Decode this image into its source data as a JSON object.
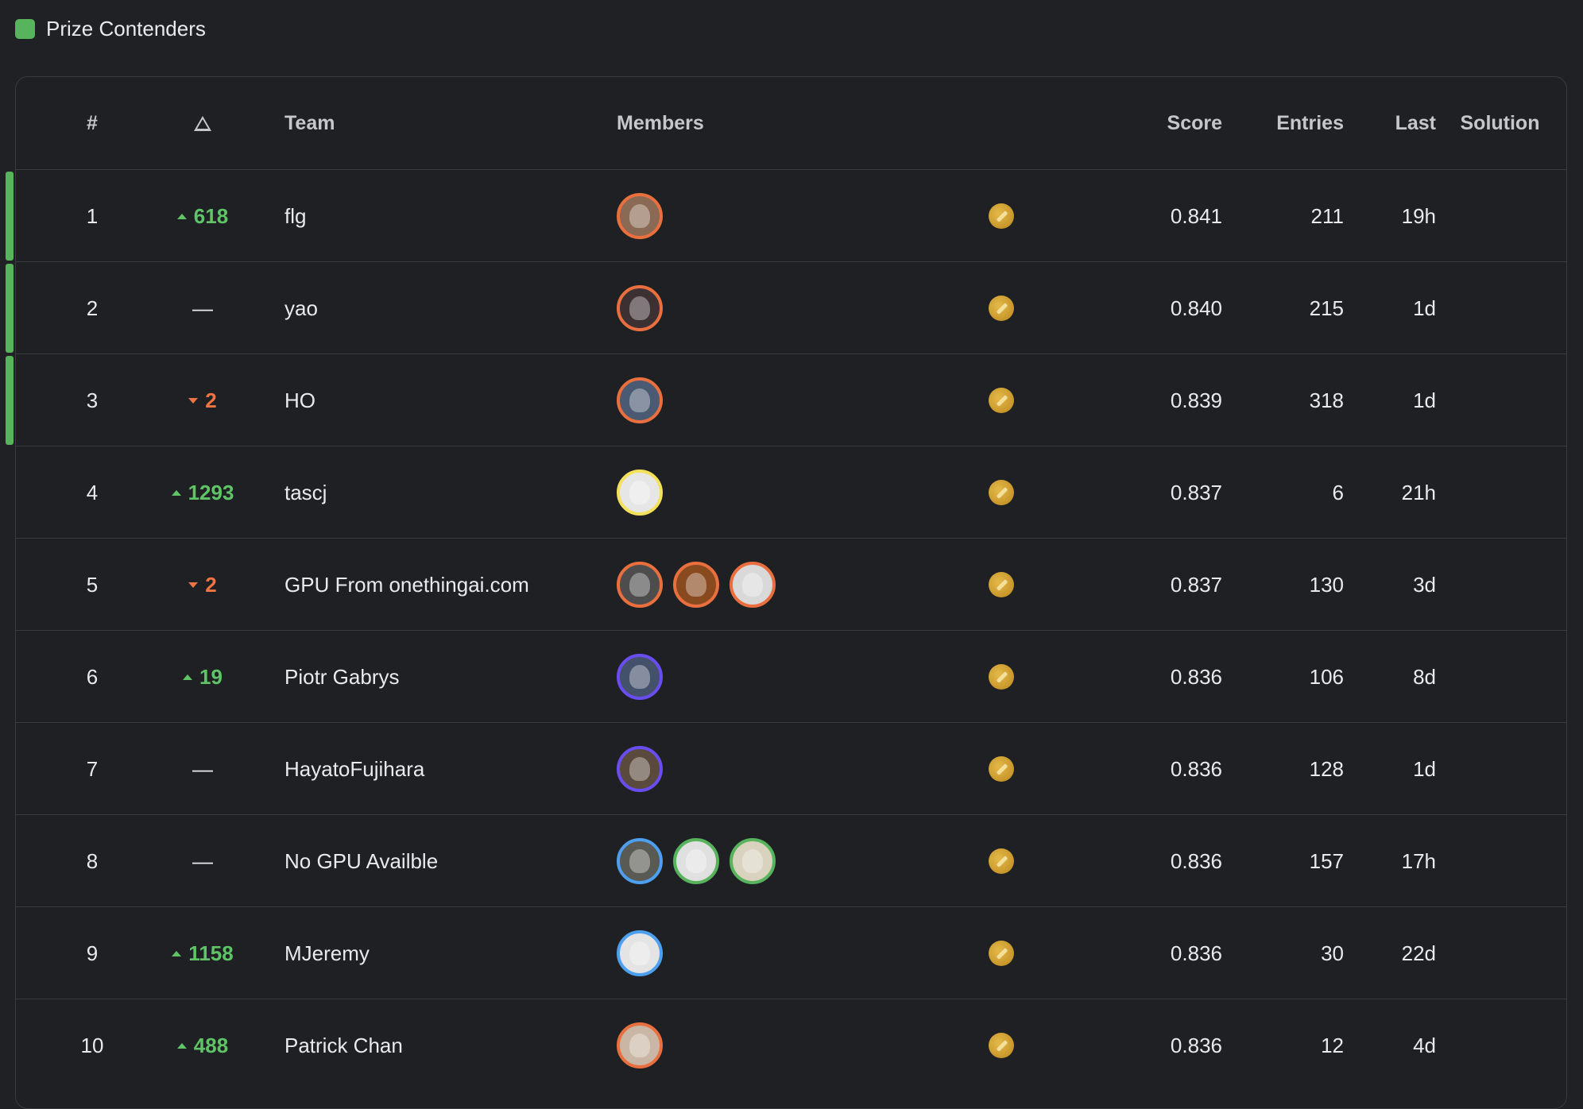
{
  "legend": {
    "label": "Prize Contenders",
    "color": "#57b35c"
  },
  "headers": {
    "rank": "#",
    "delta_icon": "delta-triangle-icon",
    "team": "Team",
    "members": "Members",
    "score": "Score",
    "entries": "Entries",
    "last": "Last",
    "solution": "Solution"
  },
  "rows": [
    {
      "rank": "1",
      "delta": "618",
      "delta_dir": "up",
      "team": "flg",
      "members": [
        {
          "ring": "#e9703e",
          "bg": "#8a6a55"
        }
      ],
      "medal": "gold-medal-icon",
      "score": "0.841",
      "entries": "211",
      "last": "19h",
      "prize": true
    },
    {
      "rank": "2",
      "delta": "—",
      "delta_dir": "none",
      "team": "yao",
      "members": [
        {
          "ring": "#e9703e",
          "bg": "#3c3033"
        }
      ],
      "medal": "gold-medal-icon",
      "score": "0.840",
      "entries": "215",
      "last": "1d",
      "prize": true
    },
    {
      "rank": "3",
      "delta": "2",
      "delta_dir": "down",
      "team": "HO",
      "members": [
        {
          "ring": "#e9703e",
          "bg": "#4a5a72"
        }
      ],
      "medal": "gold-medal-icon",
      "score": "0.839",
      "entries": "318",
      "last": "1d",
      "prize": true
    },
    {
      "rank": "4",
      "delta": "1293",
      "delta_dir": "up",
      "team": "tascj",
      "members": [
        {
          "ring": "#f3e15a",
          "bg": "#e6e6e6"
        }
      ],
      "medal": "gold-medal-icon",
      "score": "0.837",
      "entries": "6",
      "last": "21h",
      "prize": false
    },
    {
      "rank": "5",
      "delta": "2",
      "delta_dir": "down",
      "team": "GPU From onethingai.com",
      "members": [
        {
          "ring": "#e9703e",
          "bg": "#4d4d4d"
        },
        {
          "ring": "#e9703e",
          "bg": "#8a4a1f"
        },
        {
          "ring": "#e9703e",
          "bg": "#d9d9d9"
        }
      ],
      "medal": "gold-medal-icon",
      "score": "0.837",
      "entries": "130",
      "last": "3d",
      "prize": false
    },
    {
      "rank": "6",
      "delta": "19",
      "delta_dir": "up",
      "team": "Piotr Gabrys",
      "members": [
        {
          "ring": "#6a4df0",
          "bg": "#44516b"
        }
      ],
      "medal": "gold-medal-icon",
      "score": "0.836",
      "entries": "106",
      "last": "8d",
      "prize": false
    },
    {
      "rank": "7",
      "delta": "—",
      "delta_dir": "none",
      "team": "HayatoFujihara",
      "members": [
        {
          "ring": "#6a4df0",
          "bg": "#5a4a3e"
        }
      ],
      "medal": "gold-medal-icon",
      "score": "0.836",
      "entries": "128",
      "last": "1d",
      "prize": false
    },
    {
      "rank": "8",
      "delta": "—",
      "delta_dir": "none",
      "team": "No GPU Availble",
      "members": [
        {
          "ring": "#4d9ff0",
          "bg": "#5a5a55"
        },
        {
          "ring": "#57b35c",
          "bg": "#e0e0e0"
        },
        {
          "ring": "#57b35c",
          "bg": "#d8d2bf"
        }
      ],
      "medal": "gold-medal-icon",
      "score": "0.836",
      "entries": "157",
      "last": "17h",
      "prize": false
    },
    {
      "rank": "9",
      "delta": "1158",
      "delta_dir": "up",
      "team": "MJeremy",
      "members": [
        {
          "ring": "#4d9ff0",
          "bg": "#e4e4e4"
        }
      ],
      "medal": "gold-medal-icon",
      "score": "0.836",
      "entries": "30",
      "last": "22d",
      "prize": false
    },
    {
      "rank": "10",
      "delta": "488",
      "delta_dir": "up",
      "team": "Patrick Chan",
      "members": [
        {
          "ring": "#e9703e",
          "bg": "#c9b6a4"
        }
      ],
      "medal": "gold-medal-icon",
      "score": "0.836",
      "entries": "12",
      "last": "4d",
      "prize": false
    }
  ]
}
